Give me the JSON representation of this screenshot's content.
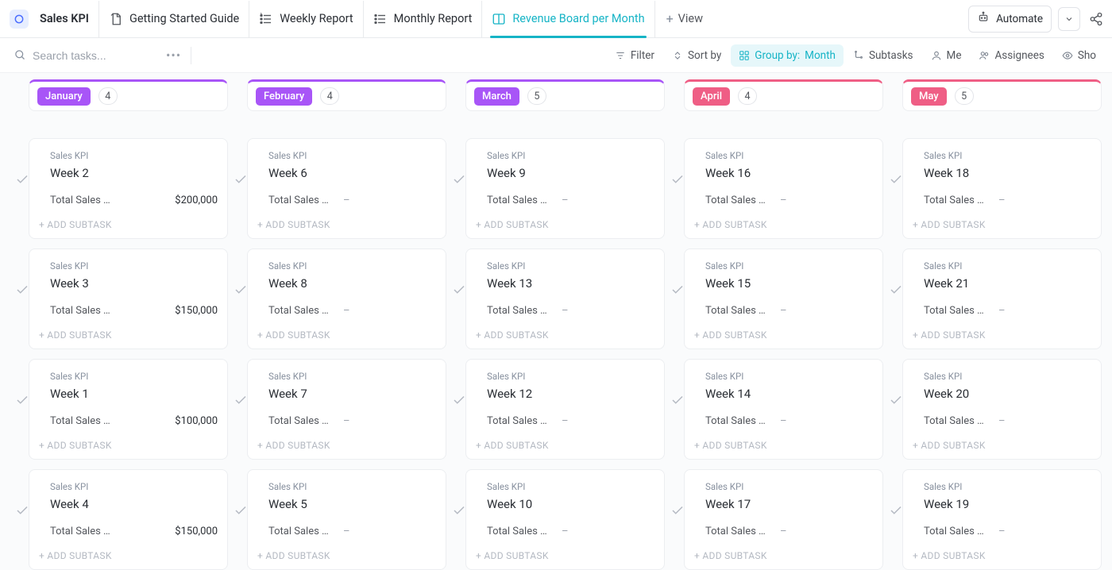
{
  "header": {
    "app_title": "Sales KPI",
    "tabs": [
      {
        "label": "Getting Started Guide",
        "icon": "doc"
      },
      {
        "label": "Weekly Report",
        "icon": "list-star"
      },
      {
        "label": "Monthly Report",
        "icon": "list"
      },
      {
        "label": "Revenue Board per Month",
        "icon": "board",
        "active": true
      }
    ],
    "view_btn": "View",
    "automate_btn": "Automate"
  },
  "toolbar": {
    "search_placeholder": "Search tasks...",
    "filter": "Filter",
    "sortby": "Sort by",
    "groupby_prefix": "Group by:",
    "groupby_value": "Month",
    "subtasks": "Subtasks",
    "me": "Me",
    "assignees": "Assignees",
    "show": "Sho"
  },
  "board": {
    "field_label": "Total Sales …",
    "add_subtask": "+ ADD SUBTASK",
    "breadcrumb": "Sales KPI",
    "empty_value": "–",
    "columns": [
      {
        "month": "January",
        "count": "4",
        "accent": "#a855f7",
        "cards": [
          {
            "title": "Week 2",
            "value": "$200,000"
          },
          {
            "title": "Week 3",
            "value": "$150,000"
          },
          {
            "title": "Week 1",
            "value": "$100,000"
          },
          {
            "title": "Week 4",
            "value": "$150,000"
          }
        ]
      },
      {
        "month": "February",
        "count": "4",
        "accent": "#a855f7",
        "cards": [
          {
            "title": "Week 6",
            "value": ""
          },
          {
            "title": "Week 8",
            "value": ""
          },
          {
            "title": "Week 7",
            "value": ""
          },
          {
            "title": "Week 5",
            "value": ""
          }
        ]
      },
      {
        "month": "March",
        "count": "5",
        "accent": "#a855f7",
        "cards": [
          {
            "title": "Week 9",
            "value": ""
          },
          {
            "title": "Week 13",
            "value": ""
          },
          {
            "title": "Week 12",
            "value": ""
          },
          {
            "title": "Week 10",
            "value": ""
          }
        ]
      },
      {
        "month": "April",
        "count": "4",
        "accent": "#ef5e85",
        "cards": [
          {
            "title": "Week 16",
            "value": ""
          },
          {
            "title": "Week 15",
            "value": ""
          },
          {
            "title": "Week 14",
            "value": ""
          },
          {
            "title": "Week 17",
            "value": ""
          }
        ]
      },
      {
        "month": "May",
        "count": "5",
        "accent": "#ef5e85",
        "cards": [
          {
            "title": "Week 18",
            "value": ""
          },
          {
            "title": "Week 21",
            "value": ""
          },
          {
            "title": "Week 20",
            "value": ""
          },
          {
            "title": "Week 19",
            "value": ""
          }
        ]
      }
    ]
  }
}
